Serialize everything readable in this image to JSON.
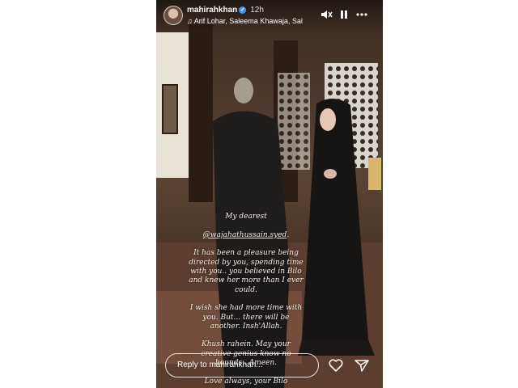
{
  "story": {
    "username": "mahirahkhan",
    "verified_icon": "verified-badge-icon",
    "time_ago": "12h",
    "music": "Arif Lohar, Saleema Khawaja, Sal",
    "controls": [
      "mute-icon",
      "pause-icon",
      "more-icon"
    ]
  },
  "caption": {
    "line1": "My dearest",
    "mention": "@wajahathussain.syed",
    "line1_suffix": ".",
    "body": "It has been a pleasure being\ndirected by you, spending time\nwith you.. you believed in Bilo\nand knew her more than I ever\ncould.\n\nI wish she had more time with\nyou. But... there will be\nanother. Insh'Allah.\n\nKhush rahein. May your\ncreative genius know no\nbounds.. Ameen.\n\nLove always, your Bilo"
  },
  "footer": {
    "reply_placeholder": "Reply to mahirahkhan...",
    "icons": [
      "heart-icon",
      "send-icon"
    ]
  },
  "colors": {
    "badge": "#3897f0",
    "text": "#ffffff"
  }
}
